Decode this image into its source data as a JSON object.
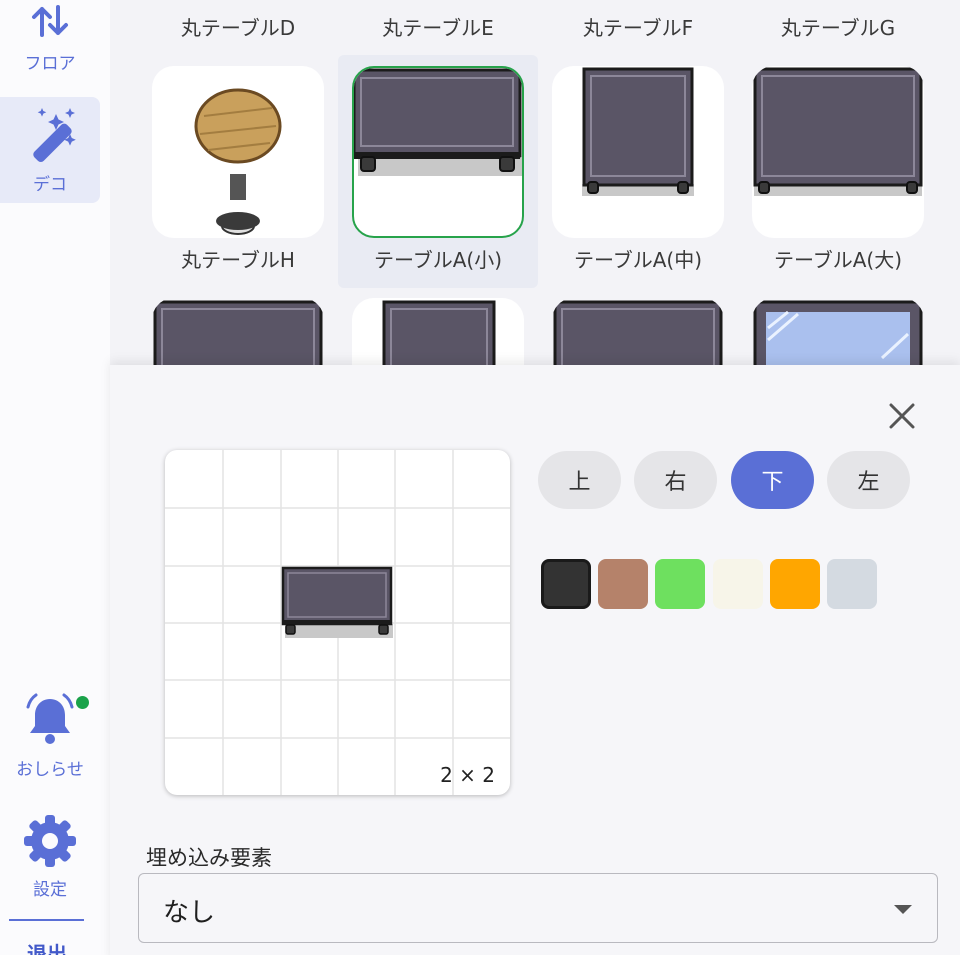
{
  "sidebar": {
    "floor_label": "フロア",
    "deco_label": "デコ",
    "notice_label": "おしらせ",
    "settings_label": "設定",
    "logout_label": "退出",
    "accent_color": "#5a6fd6",
    "notify_dot_color": "#1aa24a"
  },
  "catalog": {
    "row1_labels": [
      "丸テーブルD",
      "丸テーブルE",
      "丸テーブルF",
      "丸テーブルG"
    ],
    "row2": [
      {
        "label": "丸テーブルH",
        "icon": "round-table-icon"
      },
      {
        "label": "テーブルA(小)",
        "icon": "table-small-icon",
        "selected": true
      },
      {
        "label": "テーブルA(中)",
        "icon": "table-medium-icon"
      },
      {
        "label": "テーブルA(大)",
        "icon": "table-large-icon"
      }
    ],
    "row3_icons": [
      "table-icon",
      "table-icon",
      "table-icon",
      "glass-table-icon"
    ]
  },
  "panel": {
    "close_icon": "close-icon",
    "preview_size": "2 × 2",
    "directions": [
      {
        "label": "上",
        "active": false
      },
      {
        "label": "右",
        "active": false
      },
      {
        "label": "下",
        "active": true
      },
      {
        "label": "左",
        "active": false
      }
    ],
    "colors": [
      "#333333",
      "#b5826a",
      "#6ee05f",
      "#f7f5e9",
      "#ffa600",
      "#d4dae1"
    ],
    "selected_color_index": 0,
    "embed_label": "埋め込み要素",
    "embed_value": "なし"
  }
}
